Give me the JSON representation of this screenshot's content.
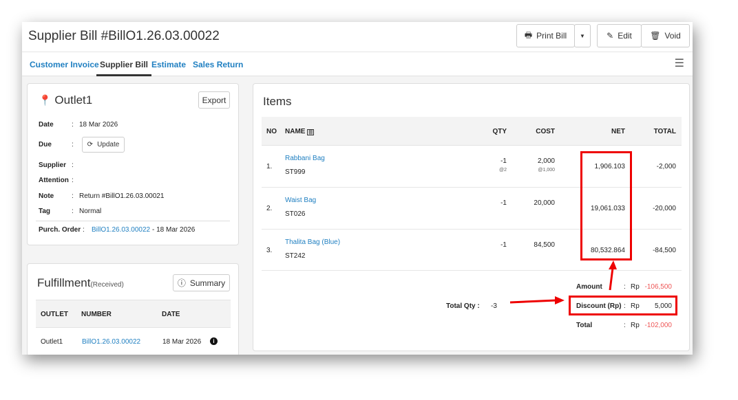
{
  "header": {
    "title": "Supplier Bill #BillO1.26.03.00022",
    "print_label": "Print Bill",
    "edit_label": "Edit",
    "void_label": "Void"
  },
  "tabs": [
    {
      "label": "Customer Invoice"
    },
    {
      "label": "Supplier Bill"
    },
    {
      "label": "Estimate"
    },
    {
      "label": "Sales Return"
    }
  ],
  "info": {
    "outlet": "Outlet1",
    "export_label": "Export",
    "update_label": "Update",
    "fields": [
      {
        "label": "Date",
        "value": "18 Mar 2026"
      },
      {
        "label": "Due",
        "value": ""
      },
      {
        "label": "Supplier",
        "value": ""
      },
      {
        "label": "Attention",
        "value": ""
      },
      {
        "label": "Note",
        "value": "Return #BillO1.26.03.00021"
      },
      {
        "label": "Tag",
        "value": "Normal"
      }
    ],
    "purch_label": "Purch. Order",
    "purch_link": "BillO1.26.03.00022",
    "purch_date": "- 18 Mar 2026"
  },
  "fulfillment": {
    "title": "Fulfillment",
    "status": "(Received)",
    "summary_label": "Summary",
    "headers": [
      "OUTLET",
      "NUMBER",
      "DATE"
    ],
    "row": [
      "Outlet1",
      "BillO1.26.03.00022",
      "18 Mar 2026"
    ]
  },
  "items": {
    "title": "Items",
    "headers": [
      "NO",
      "NAME",
      "QTY",
      "COST",
      "NET",
      "TOTAL"
    ],
    "rows": [
      {
        "no": "1.",
        "name": "Rabbani Bag",
        "sku": "ST999",
        "qty": "-1",
        "qty_sub": "@2",
        "cost": "2,000",
        "cost_sub": "@1,000",
        "net": "1,906.103",
        "total": "-2,000"
      },
      {
        "no": "2.",
        "name": "Waist Bag",
        "sku": "ST026",
        "qty": "-1",
        "qty_sub": "",
        "cost": "20,000",
        "cost_sub": "",
        "net": "19,061.033",
        "total": "-20,000"
      },
      {
        "no": "3.",
        "name": "Thalita Bag (Blue)",
        "sku": "ST242",
        "qty": "-1",
        "qty_sub": "",
        "cost": "84,500",
        "cost_sub": "",
        "net": "80,532.864",
        "total": "-84,500"
      }
    ],
    "total_qty_label": "Total Qty :",
    "total_qty": "-3",
    "summary": [
      {
        "label": "Amount",
        "cur": "Rp",
        "value": "-106,500"
      },
      {
        "label": "Discount (Rp)",
        "cur": "Rp",
        "value": "5,000"
      },
      {
        "label": "Total",
        "cur": "Rp",
        "value": "-102,000"
      }
    ]
  },
  "colors": {
    "link": "#1f7fc1",
    "negative": "#e55555",
    "highlight": "#ee0000"
  }
}
